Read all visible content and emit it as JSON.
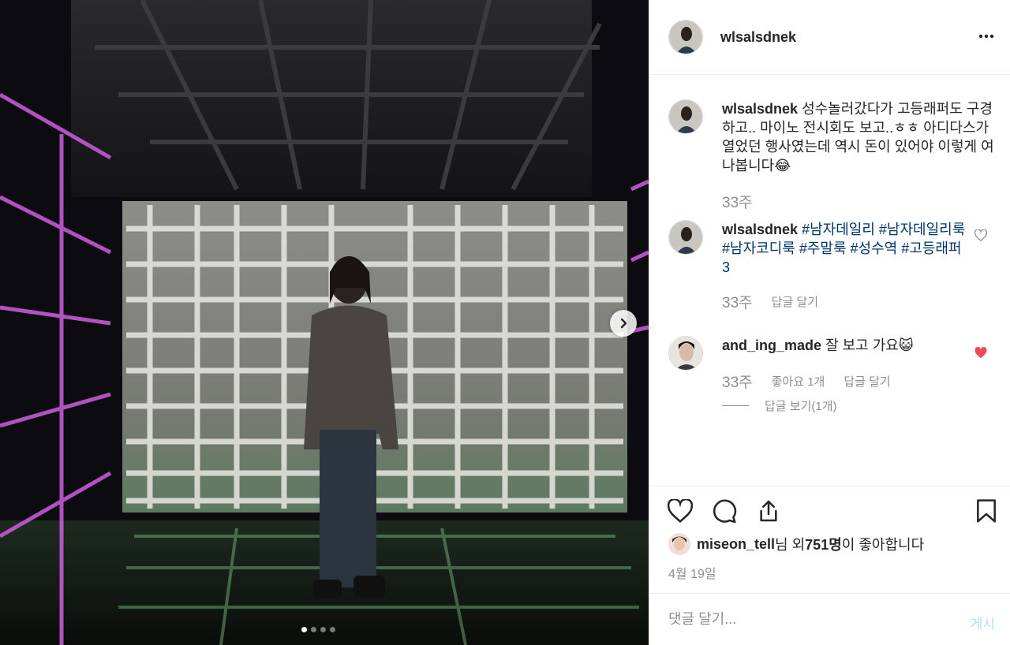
{
  "header": {
    "username": "wlsalsdnek"
  },
  "caption": {
    "username": "wlsalsdnek",
    "text": "성수놀러갔다가 고등래퍼도 구경하고.. 마이노 전시회도 보고..ㅎㅎ 아디다스가 열었던 행사였는데 역시 돈이 있어야 이렇게 여나봅니다",
    "emoji": "😂",
    "time": "33주"
  },
  "comment1": {
    "username": "wlsalsdnek",
    "tags": [
      "#남자데일리",
      "#남자데일리룩",
      "#남자코디룩",
      "#주말룩",
      "#성수역",
      "#고등래퍼3"
    ],
    "time": "33주",
    "reply_label": "답글 달기"
  },
  "comment2": {
    "username": "and_ing_made",
    "text": "잘 보고 가요",
    "emoji": "😺",
    "time": "33주",
    "likes_label": "좋아요 1개",
    "reply_label": "답글 달기",
    "view_replies": "답글 보기(1개)"
  },
  "likes": {
    "user": "miseon_tell",
    "middle": "님 외 ",
    "count": "751명",
    "suffix": "이 좋아합니다"
  },
  "date": "4월 19일",
  "comment_box": {
    "placeholder": "댓글 달기...",
    "post_label": "게시"
  },
  "carousel": {
    "total": 4,
    "current": 1
  },
  "colors": {
    "link": "#00376b",
    "muted": "#8e8e8e",
    "liked_heart": "#ed4956",
    "post_button": "#b2dffc"
  },
  "icons": [
    "more-options-icon",
    "heart-icon",
    "comment-icon",
    "share-icon",
    "bookmark-icon",
    "chevron-right-icon"
  ]
}
